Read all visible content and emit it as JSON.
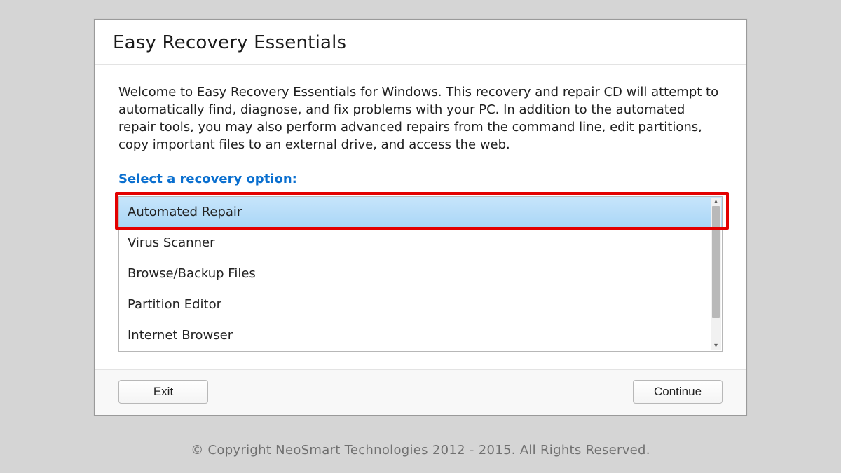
{
  "dialog": {
    "title": "Easy Recovery Essentials",
    "welcome_text": "Welcome to Easy Recovery Essentials for Windows. This recovery and repair CD will attempt to automatically find, diagnose, and fix problems with your PC. In addition to the automated repair tools, you may also perform advanced repairs from the command line, edit partitions, copy important files to an external drive, and access the web.",
    "prompt_label": "Select a recovery option:",
    "options": [
      "Automated Repair",
      "Virus Scanner",
      "Browse/Backup Files",
      "Partition Editor",
      "Internet Browser"
    ],
    "selected_index": 0,
    "buttons": {
      "exit": "Exit",
      "continue": "Continue"
    }
  },
  "footer": {
    "copyright": "© Copyright NeoSmart Technologies 2012 - 2015. All Rights Reserved."
  },
  "colors": {
    "accent": "#0a6fcf",
    "highlight": "#e30000",
    "selected_bg_top": "#c7e5fb",
    "selected_bg_bottom": "#a9d6f6"
  }
}
